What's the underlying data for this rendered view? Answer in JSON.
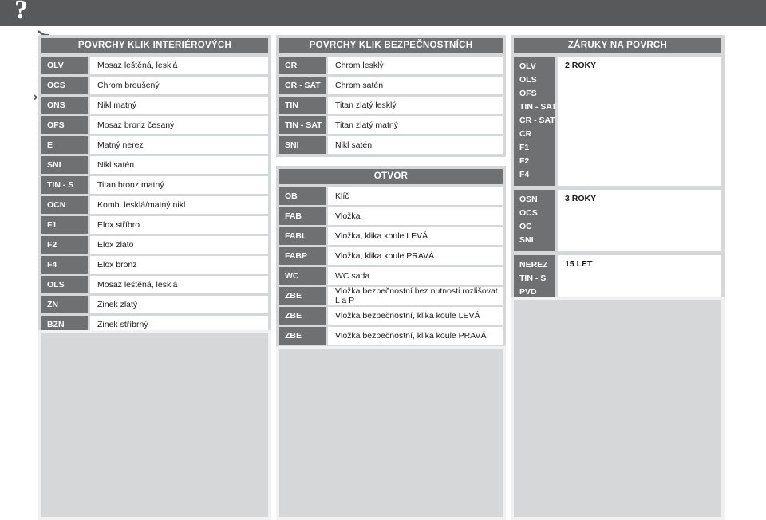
{
  "topbar": {
    "mark": "?"
  },
  "side_title": "VYSVĚTLIVKY",
  "colors": {
    "bar_dark": "#58595b",
    "header_gray": "#6e7072",
    "panel_gray": "#d6d7d9",
    "cell_white": "#ffffff"
  },
  "tables": {
    "interior": {
      "title": "POVRCHY KLIK INTERIÉROVÝCH",
      "rows": [
        {
          "code": "OLV",
          "desc": "Mosaz leštěná, lesklá"
        },
        {
          "code": "OCS",
          "desc": "Chrom broušený"
        },
        {
          "code": "ONS",
          "desc": "Nikl matný"
        },
        {
          "code": "OFS",
          "desc": "Mosaz bronz česaný"
        },
        {
          "code": "E",
          "desc": "Matný nerez"
        },
        {
          "code": "SNI",
          "desc": "Nikl satén"
        },
        {
          "code": "TIN - S",
          "desc": "Titan bronz matný"
        },
        {
          "code": "OCN",
          "desc": "Komb. lesklá/matný nikl"
        },
        {
          "code": "F1",
          "desc": "Elox stříbro"
        },
        {
          "code": "F2",
          "desc": "Elox zlato"
        },
        {
          "code": "F4",
          "desc": "Elox bronz"
        },
        {
          "code": "OLS",
          "desc": "Mosaz leštěná, lesklá"
        },
        {
          "code": "ZN",
          "desc": "Zinek zlatý"
        },
        {
          "code": "BZN",
          "desc": "Zinek stříbrný"
        }
      ]
    },
    "security": {
      "title": "POVRCHY KLIK BEZPEČNOSTNÍCH",
      "rows": [
        {
          "code": "CR",
          "desc": "Chrom lesklý"
        },
        {
          "code": "CR - SAT",
          "desc": "Chrom satén"
        },
        {
          "code": "TIN",
          "desc": "Titan zlatý lesklý"
        },
        {
          "code": "TIN - SAT",
          "desc": "Titan zlatý matný"
        },
        {
          "code": "SNI",
          "desc": "Nikl satén"
        }
      ]
    },
    "opening": {
      "title": "OTVOR",
      "rows": [
        {
          "code": "OB",
          "desc": "Klíč"
        },
        {
          "code": "FAB",
          "desc": "Vložka"
        },
        {
          "code": "FABL",
          "desc": "Vložka, klika koule LEVÁ"
        },
        {
          "code": "FABP",
          "desc": "Vložka, klika koule PRAVÁ"
        },
        {
          "code": "WC",
          "desc": "WC sada"
        },
        {
          "code": "ZBE",
          "desc": "Vložka bezpečnostní bez nutnosti rozlišovat L a P"
        },
        {
          "code": "ZBE",
          "desc": "Vložka bezpečnostní, klika koule LEVÁ"
        },
        {
          "code": "ZBE",
          "desc": "Vložka bezpečnostní, klika koule PRAVÁ"
        }
      ]
    },
    "warranty": {
      "title": "ZÁRUKY NA POVRCH",
      "groups": [
        {
          "codes": [
            "OLV",
            "OLS",
            "OFS",
            "TIN - SAT",
            "CR - SAT",
            "CR",
            "F1",
            "F2",
            "F4"
          ],
          "value": "2 ROKY"
        },
        {
          "codes": [
            "OSN",
            "OCS",
            "OC",
            "SNI"
          ],
          "value": "3 ROKY"
        },
        {
          "codes": [
            "NEREZ",
            "TIN - S",
            "PVD"
          ],
          "value": "15 LET"
        }
      ]
    }
  }
}
